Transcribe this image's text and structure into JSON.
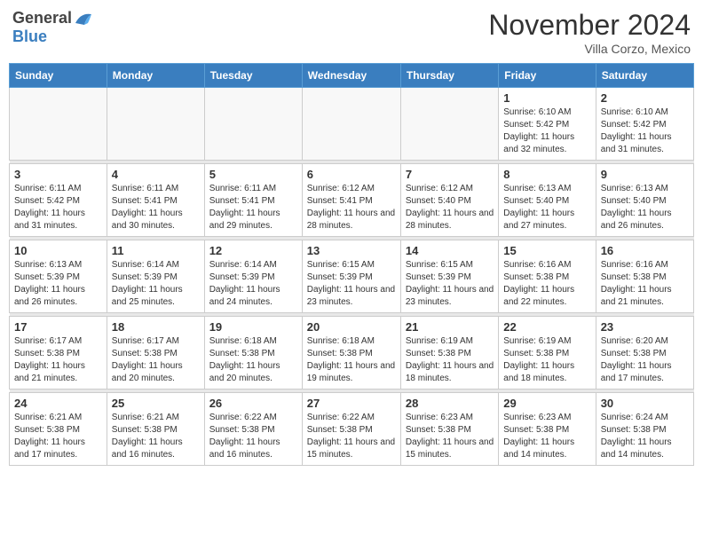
{
  "header": {
    "logo_general": "General",
    "logo_blue": "Blue",
    "month": "November 2024",
    "location": "Villa Corzo, Mexico"
  },
  "days_of_week": [
    "Sunday",
    "Monday",
    "Tuesday",
    "Wednesday",
    "Thursday",
    "Friday",
    "Saturday"
  ],
  "weeks": [
    [
      {
        "day": "",
        "info": ""
      },
      {
        "day": "",
        "info": ""
      },
      {
        "day": "",
        "info": ""
      },
      {
        "day": "",
        "info": ""
      },
      {
        "day": "",
        "info": ""
      },
      {
        "day": "1",
        "info": "Sunrise: 6:10 AM\nSunset: 5:42 PM\nDaylight: 11 hours and 32 minutes."
      },
      {
        "day": "2",
        "info": "Sunrise: 6:10 AM\nSunset: 5:42 PM\nDaylight: 11 hours and 31 minutes."
      }
    ],
    [
      {
        "day": "3",
        "info": "Sunrise: 6:11 AM\nSunset: 5:42 PM\nDaylight: 11 hours and 31 minutes."
      },
      {
        "day": "4",
        "info": "Sunrise: 6:11 AM\nSunset: 5:41 PM\nDaylight: 11 hours and 30 minutes."
      },
      {
        "day": "5",
        "info": "Sunrise: 6:11 AM\nSunset: 5:41 PM\nDaylight: 11 hours and 29 minutes."
      },
      {
        "day": "6",
        "info": "Sunrise: 6:12 AM\nSunset: 5:41 PM\nDaylight: 11 hours and 28 minutes."
      },
      {
        "day": "7",
        "info": "Sunrise: 6:12 AM\nSunset: 5:40 PM\nDaylight: 11 hours and 28 minutes."
      },
      {
        "day": "8",
        "info": "Sunrise: 6:13 AM\nSunset: 5:40 PM\nDaylight: 11 hours and 27 minutes."
      },
      {
        "day": "9",
        "info": "Sunrise: 6:13 AM\nSunset: 5:40 PM\nDaylight: 11 hours and 26 minutes."
      }
    ],
    [
      {
        "day": "10",
        "info": "Sunrise: 6:13 AM\nSunset: 5:39 PM\nDaylight: 11 hours and 26 minutes."
      },
      {
        "day": "11",
        "info": "Sunrise: 6:14 AM\nSunset: 5:39 PM\nDaylight: 11 hours and 25 minutes."
      },
      {
        "day": "12",
        "info": "Sunrise: 6:14 AM\nSunset: 5:39 PM\nDaylight: 11 hours and 24 minutes."
      },
      {
        "day": "13",
        "info": "Sunrise: 6:15 AM\nSunset: 5:39 PM\nDaylight: 11 hours and 23 minutes."
      },
      {
        "day": "14",
        "info": "Sunrise: 6:15 AM\nSunset: 5:39 PM\nDaylight: 11 hours and 23 minutes."
      },
      {
        "day": "15",
        "info": "Sunrise: 6:16 AM\nSunset: 5:38 PM\nDaylight: 11 hours and 22 minutes."
      },
      {
        "day": "16",
        "info": "Sunrise: 6:16 AM\nSunset: 5:38 PM\nDaylight: 11 hours and 21 minutes."
      }
    ],
    [
      {
        "day": "17",
        "info": "Sunrise: 6:17 AM\nSunset: 5:38 PM\nDaylight: 11 hours and 21 minutes."
      },
      {
        "day": "18",
        "info": "Sunrise: 6:17 AM\nSunset: 5:38 PM\nDaylight: 11 hours and 20 minutes."
      },
      {
        "day": "19",
        "info": "Sunrise: 6:18 AM\nSunset: 5:38 PM\nDaylight: 11 hours and 20 minutes."
      },
      {
        "day": "20",
        "info": "Sunrise: 6:18 AM\nSunset: 5:38 PM\nDaylight: 11 hours and 19 minutes."
      },
      {
        "day": "21",
        "info": "Sunrise: 6:19 AM\nSunset: 5:38 PM\nDaylight: 11 hours and 18 minutes."
      },
      {
        "day": "22",
        "info": "Sunrise: 6:19 AM\nSunset: 5:38 PM\nDaylight: 11 hours and 18 minutes."
      },
      {
        "day": "23",
        "info": "Sunrise: 6:20 AM\nSunset: 5:38 PM\nDaylight: 11 hours and 17 minutes."
      }
    ],
    [
      {
        "day": "24",
        "info": "Sunrise: 6:21 AM\nSunset: 5:38 PM\nDaylight: 11 hours and 17 minutes."
      },
      {
        "day": "25",
        "info": "Sunrise: 6:21 AM\nSunset: 5:38 PM\nDaylight: 11 hours and 16 minutes."
      },
      {
        "day": "26",
        "info": "Sunrise: 6:22 AM\nSunset: 5:38 PM\nDaylight: 11 hours and 16 minutes."
      },
      {
        "day": "27",
        "info": "Sunrise: 6:22 AM\nSunset: 5:38 PM\nDaylight: 11 hours and 15 minutes."
      },
      {
        "day": "28",
        "info": "Sunrise: 6:23 AM\nSunset: 5:38 PM\nDaylight: 11 hours and 15 minutes."
      },
      {
        "day": "29",
        "info": "Sunrise: 6:23 AM\nSunset: 5:38 PM\nDaylight: 11 hours and 14 minutes."
      },
      {
        "day": "30",
        "info": "Sunrise: 6:24 AM\nSunset: 5:38 PM\nDaylight: 11 hours and 14 minutes."
      }
    ]
  ]
}
